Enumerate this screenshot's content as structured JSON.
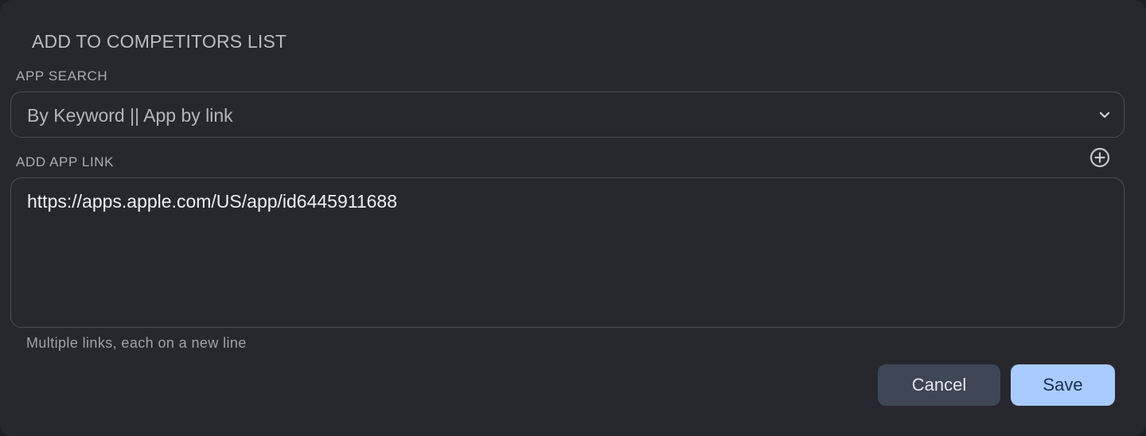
{
  "dialog": {
    "title": "ADD TO COMPETITORS LIST"
  },
  "app_search": {
    "label": "APP SEARCH",
    "selected_value": "By Keyword || App by link"
  },
  "add_app_link": {
    "label": "ADD APP LINK",
    "value": "https://apps.apple.com/US/app/id6445911688",
    "helper_text": "Multiple links, each on a new line"
  },
  "actions": {
    "cancel_label": "Cancel",
    "save_label": "Save"
  },
  "icons": {
    "select_chevron": "chevron-down-icon",
    "add_link": "plus-circle-icon"
  },
  "colors": {
    "dialog_background": "#27282e",
    "save_button": "#a9cbff",
    "cancel_button": "#3f4656"
  }
}
